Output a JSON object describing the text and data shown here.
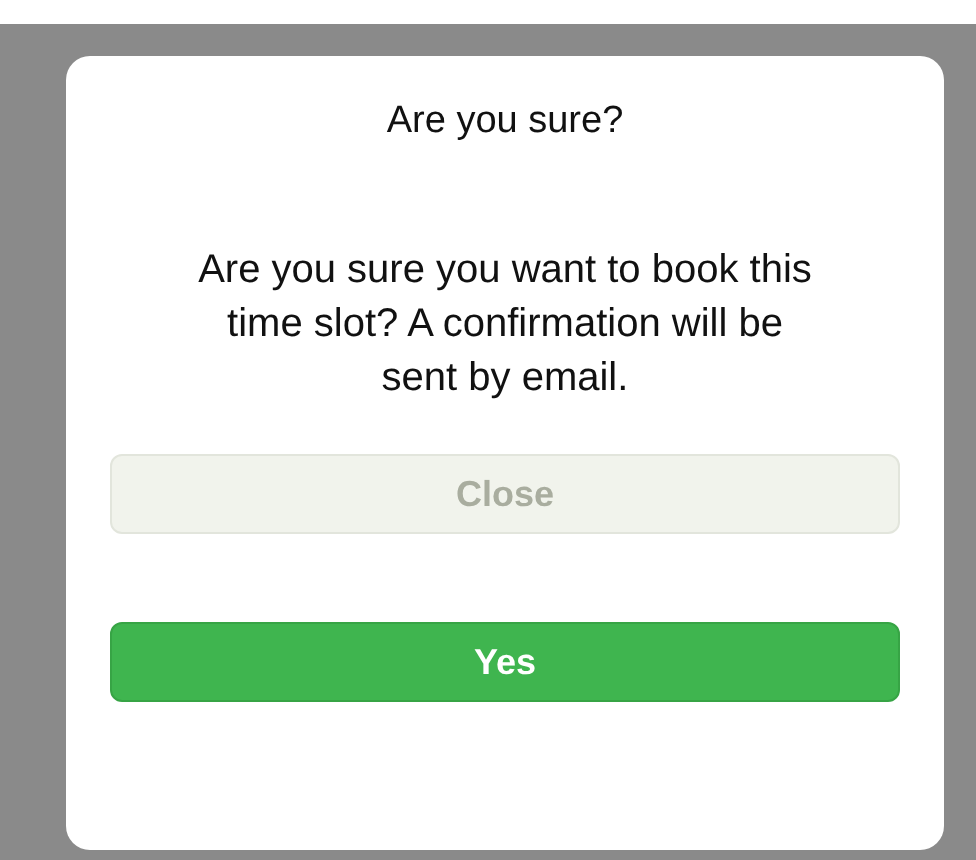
{
  "dialog": {
    "title": "Are you sure?",
    "message": "Are you sure you want to book this time slot? A confirmation will be sent by email.",
    "buttons": [
      {
        "label": "Close",
        "kind": "secondary",
        "disabled": true
      },
      {
        "label": "Yes",
        "kind": "primary",
        "disabled": false
      }
    ]
  }
}
